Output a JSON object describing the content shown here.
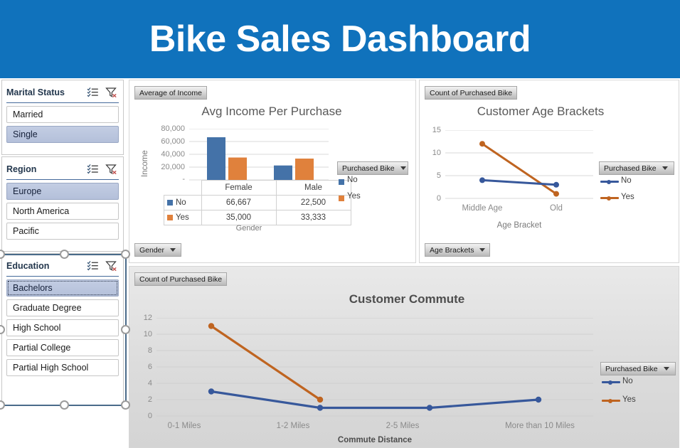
{
  "header": {
    "title": "Bike Sales Dashboard",
    "bg_color": "#1072BC"
  },
  "colors": {
    "series_no": "#4472A8",
    "series_yes": "#E0813C",
    "line_no": "#37589B",
    "line_yes": "#BF6420",
    "slicer_selected": "#B8C4DE",
    "grid": "#d9d9d9"
  },
  "slicers": [
    {
      "title": "Marital Status",
      "icons": [
        "multi-select-icon",
        "clear-filter-icon"
      ],
      "items": [
        {
          "label": "Married",
          "selected": false
        },
        {
          "label": "Single",
          "selected": true
        }
      ]
    },
    {
      "title": "Region",
      "icons": [
        "multi-select-icon",
        "clear-filter-icon"
      ],
      "items": [
        {
          "label": "Europe",
          "selected": true
        },
        {
          "label": "North America",
          "selected": false
        },
        {
          "label": "Pacific",
          "selected": false
        }
      ]
    },
    {
      "title": "Education",
      "icons": [
        "multi-select-icon",
        "clear-filter-icon"
      ],
      "selected_object": true,
      "items": [
        {
          "label": "Bachelors",
          "selected": true
        },
        {
          "label": "Graduate Degree",
          "selected": false
        },
        {
          "label": "High School",
          "selected": false
        },
        {
          "label": "Partial College",
          "selected": false
        },
        {
          "label": "Partial High School",
          "selected": false
        }
      ]
    }
  ],
  "charts": {
    "income": {
      "value_field_button": "Average of Income",
      "axis_field_button": "Gender",
      "legend_field_button": "Purchased Bike",
      "chart_data": {
        "type": "bar",
        "title": "Avg Income Per Purchase",
        "xlabel": "Gender",
        "ylabel": "Income",
        "categories": [
          "Female",
          "Male"
        ],
        "series": [
          {
            "name": "No",
            "values": [
              66667,
              22500
            ],
            "labels": [
              "66,667",
              "22,500"
            ],
            "color": "#4472A8"
          },
          {
            "name": "Yes",
            "values": [
              35000,
              33333
            ],
            "labels": [
              "35,000",
              "33,333"
            ],
            "color": "#E0813C"
          }
        ],
        "yticks": [
          "80,000",
          "60,000",
          "40,000",
          "20,000",
          "-"
        ],
        "ylim": [
          0,
          80000
        ],
        "grid": true,
        "legend_position": "right",
        "data_table": true
      }
    },
    "age": {
      "value_field_button": "Count of Purchased Bike",
      "axis_field_button": "Age Brackets",
      "legend_field_button": "Purchased Bike",
      "chart_data": {
        "type": "line",
        "title": "Customer Age Brackets",
        "xlabel": "Age Bracket",
        "ylabel": "",
        "categories": [
          "Middle Age",
          "Old"
        ],
        "series": [
          {
            "name": "No",
            "values": [
              4,
              3
            ],
            "color": "#37589B"
          },
          {
            "name": "Yes",
            "values": [
              12,
              1
            ],
            "color": "#BF6420"
          }
        ],
        "yticks": [
          "15",
          "10",
          "5",
          "0"
        ],
        "ylim": [
          0,
          15
        ],
        "grid": true,
        "legend_position": "right"
      }
    },
    "commute": {
      "value_field_button": "Count of Purchased Bike",
      "legend_field_button": "Purchased Bike",
      "chart_data": {
        "type": "line",
        "title": "Customer Commute",
        "xlabel": "Commute Distance",
        "ylabel": "",
        "categories": [
          "0-1 Miles",
          "1-2 Miles",
          "2-5 Miles",
          "More than 10 Miles"
        ],
        "series": [
          {
            "name": "No",
            "values": [
              3,
              1,
              1,
              2
            ],
            "color": "#37589B"
          },
          {
            "name": "Yes",
            "values": [
              11,
              2,
              null,
              null
            ],
            "color": "#BF6420"
          }
        ],
        "yticks": [
          "12",
          "10",
          "8",
          "6",
          "4",
          "2",
          "0"
        ],
        "ylim": [
          0,
          12
        ],
        "grid": true,
        "legend_position": "right"
      }
    }
  }
}
